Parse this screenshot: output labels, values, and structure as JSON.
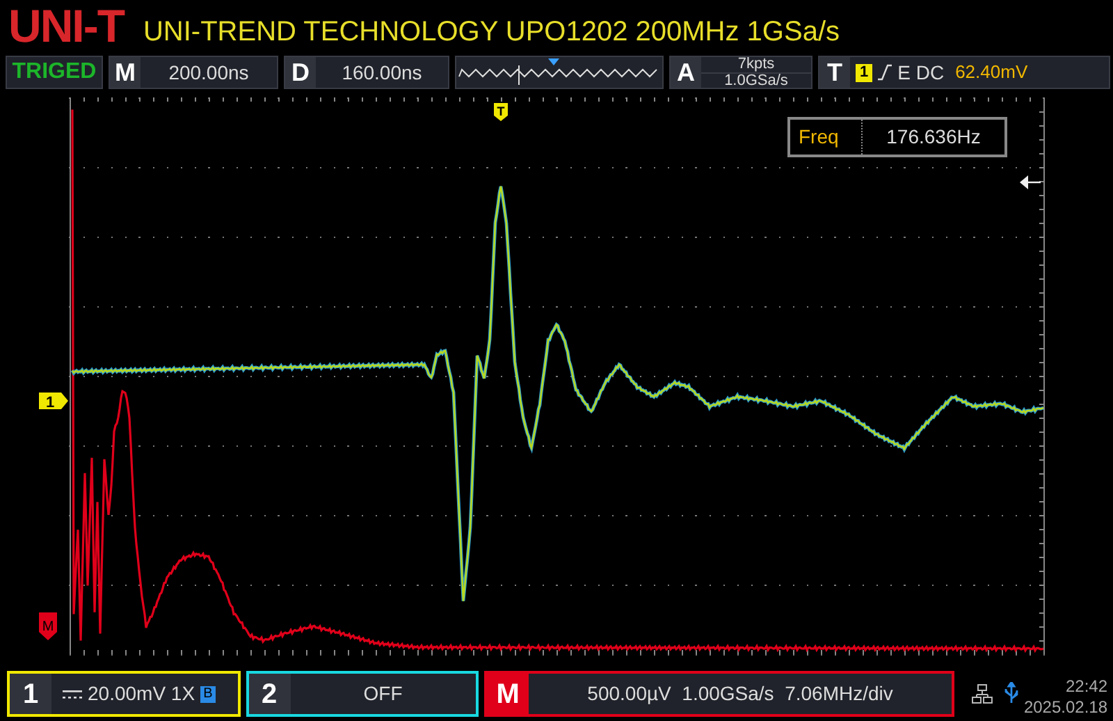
{
  "header": {
    "logo": "UNI-T",
    "title": "UNI-TREND TECHNOLOGY UPO1202 200MHz 1GSa/s"
  },
  "toolbar": {
    "status": "TRIGED",
    "timebase": {
      "key": "M",
      "value": "200.00ns"
    },
    "delay": {
      "key": "D",
      "value": "160.00ns"
    },
    "acquire": {
      "key": "A",
      "depth": "7kpts",
      "rate": "1.0GSa/s"
    },
    "trigger": {
      "key": "T",
      "source": "1",
      "mode": "E DC",
      "level": "62.40mV"
    }
  },
  "measurement": {
    "label": "Freq",
    "value": "176.636Hz"
  },
  "markers": {
    "trigger": "T",
    "channel": "1",
    "math": "M"
  },
  "channels": [
    {
      "number": "1",
      "scale": "20.00mV 1X",
      "bandwidth": "B",
      "color": "#f0e800"
    },
    {
      "number": "2",
      "scale": "OFF",
      "color": "#18d8e0"
    }
  ],
  "math": {
    "key": "M",
    "readout": "500.00µV  1.00GSa/s  7.06MHz/div",
    "color": "#e0001a"
  },
  "clock": {
    "time": "22:42",
    "date": "2025.02.18"
  }
}
